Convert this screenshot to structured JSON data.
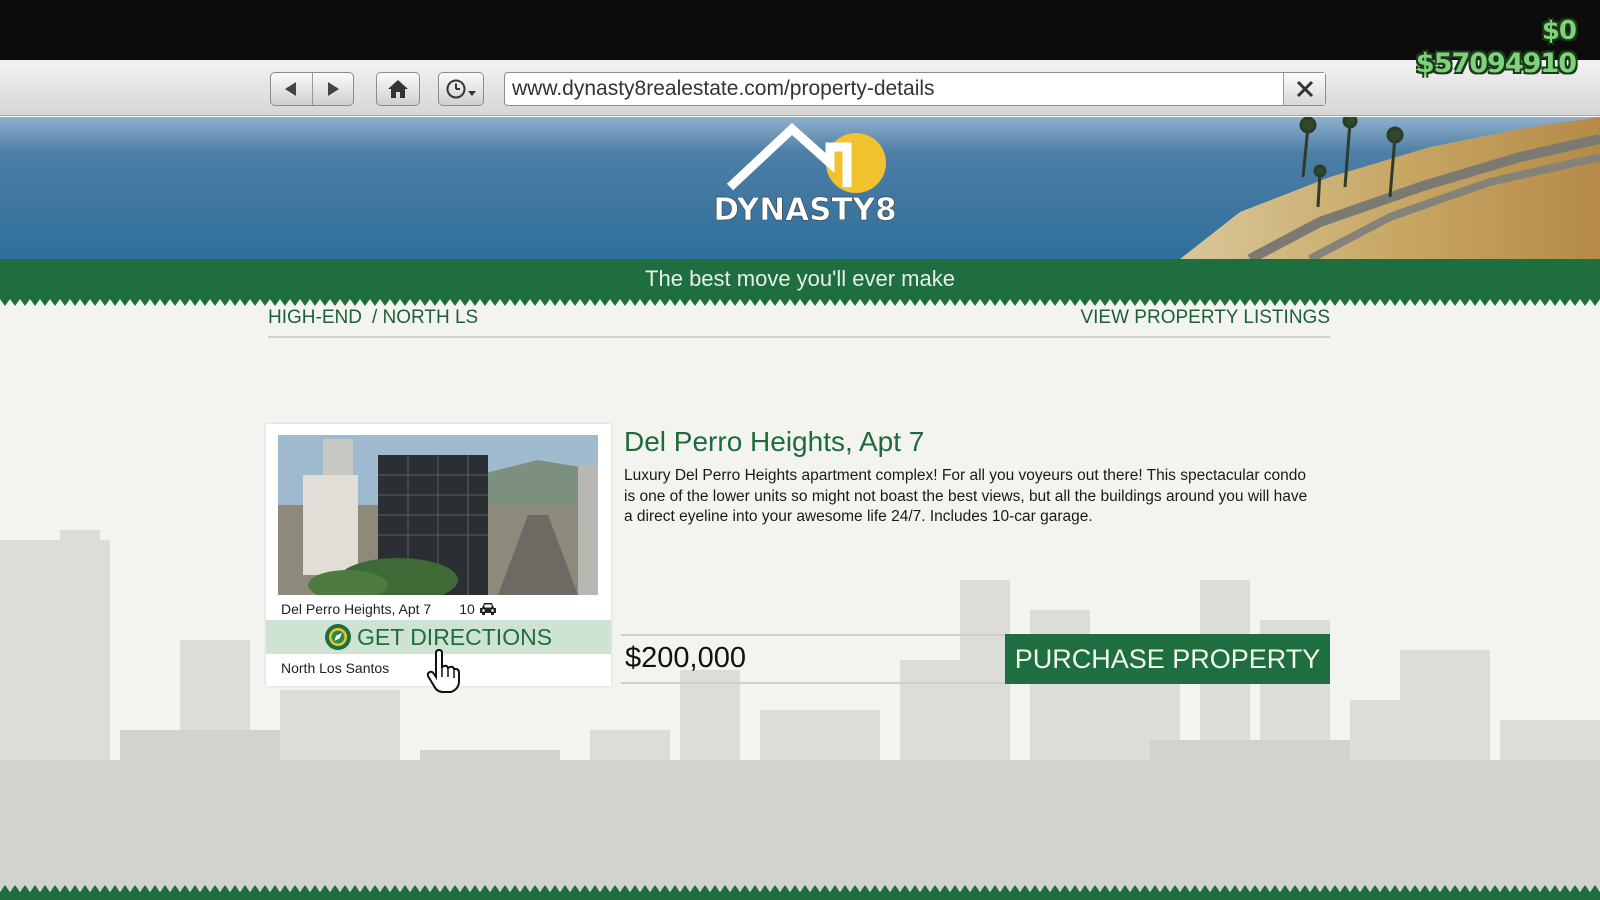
{
  "hud": {
    "cash": "$0",
    "bank": "$57094910"
  },
  "browser": {
    "url": "www.dynasty8realestate.com/property-details",
    "buttons": [
      "back-icon",
      "forward-icon",
      "home-icon",
      "history-icon",
      "close-icon"
    ]
  },
  "site": {
    "logo_text": "DYNASTY8",
    "tagline": "The best move you'll ever make"
  },
  "breadcrumb": {
    "category": "HIGH-END",
    "area": "/ NORTH LS",
    "listings_link": "VIEW PROPERTY LISTINGS"
  },
  "property": {
    "card_name": "Del Perro Heights, Apt 7",
    "garage_count": "10",
    "directions_label": "GET DIRECTIONS",
    "area": "North Los Santos",
    "title": "Del Perro Heights, Apt 7",
    "description": "Luxury Del Perro Heights apartment complex! For all you voyeurs out there! This spectacular condo is one of the lower units so might not boast the best views, but all the buildings around you will have a direct eyeline into your awesome life 24/7. Includes 10-car garage.",
    "price": "$200,000",
    "purchase_label": "PURCHASE PROPERTY"
  },
  "colors": {
    "brand_green": "#1e6e40",
    "hud_green": "#7ed27a",
    "logo_sun": "#f2c22e"
  }
}
